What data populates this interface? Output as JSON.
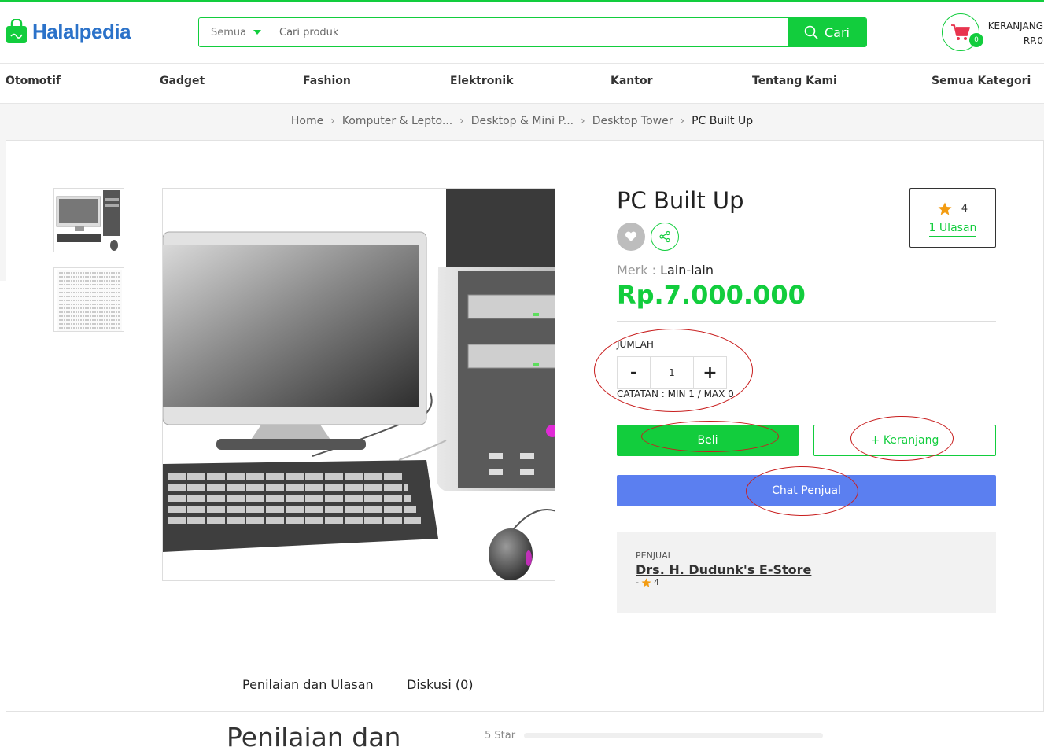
{
  "header": {
    "logo_text": "Halalpedia",
    "search_category": "Semua",
    "search_placeholder": "Cari produk",
    "search_button": "Cari",
    "cart_count": "0",
    "cart_label": "KERANJANG",
    "cart_total": "RP.0"
  },
  "nav": {
    "items": [
      "Otomotif",
      "Gadget",
      "Fashion",
      "Elektronik",
      "Kantor",
      "Tentang Kami",
      "Semua Kategori"
    ]
  },
  "breadcrumb": {
    "items": [
      "Home",
      "Komputer & Lepto...",
      "Desktop & Mini P...",
      "Desktop Tower",
      "PC Built Up"
    ]
  },
  "product": {
    "title": "PC Built Up",
    "rating": "4",
    "reviews_link": "1 Ulasan",
    "brand_label": "Merk :",
    "brand_value": "Lain-lain",
    "price": "Rp.7.000.000",
    "qty_label": "JUMLAH",
    "qty_minus": "-",
    "qty_value": "1",
    "qty_plus": "+",
    "qty_note": "CATATAN : MIN 1 / MAX 0",
    "buy_button": "Beli",
    "add_cart_button": "+ Keranjang",
    "chat_button": "Chat Penjual"
  },
  "seller": {
    "label": "PENJUAL",
    "name": "Drs. H. Dudunk's E-Store",
    "prefix": "-",
    "rating": "4"
  },
  "tabs": [
    "Penilaian dan Ulasan",
    "Diskusi (0)"
  ],
  "reviews": {
    "title": "Penilaian dan",
    "bar_label": "5 Star",
    "bar_fill": 0
  },
  "colors": {
    "brand_green": "#12cd3d",
    "chat_blue": "#5b7ff0",
    "logo_blue": "#2b72c9",
    "star_orange": "#f39c12",
    "annotation_red": "#c81e1e"
  }
}
